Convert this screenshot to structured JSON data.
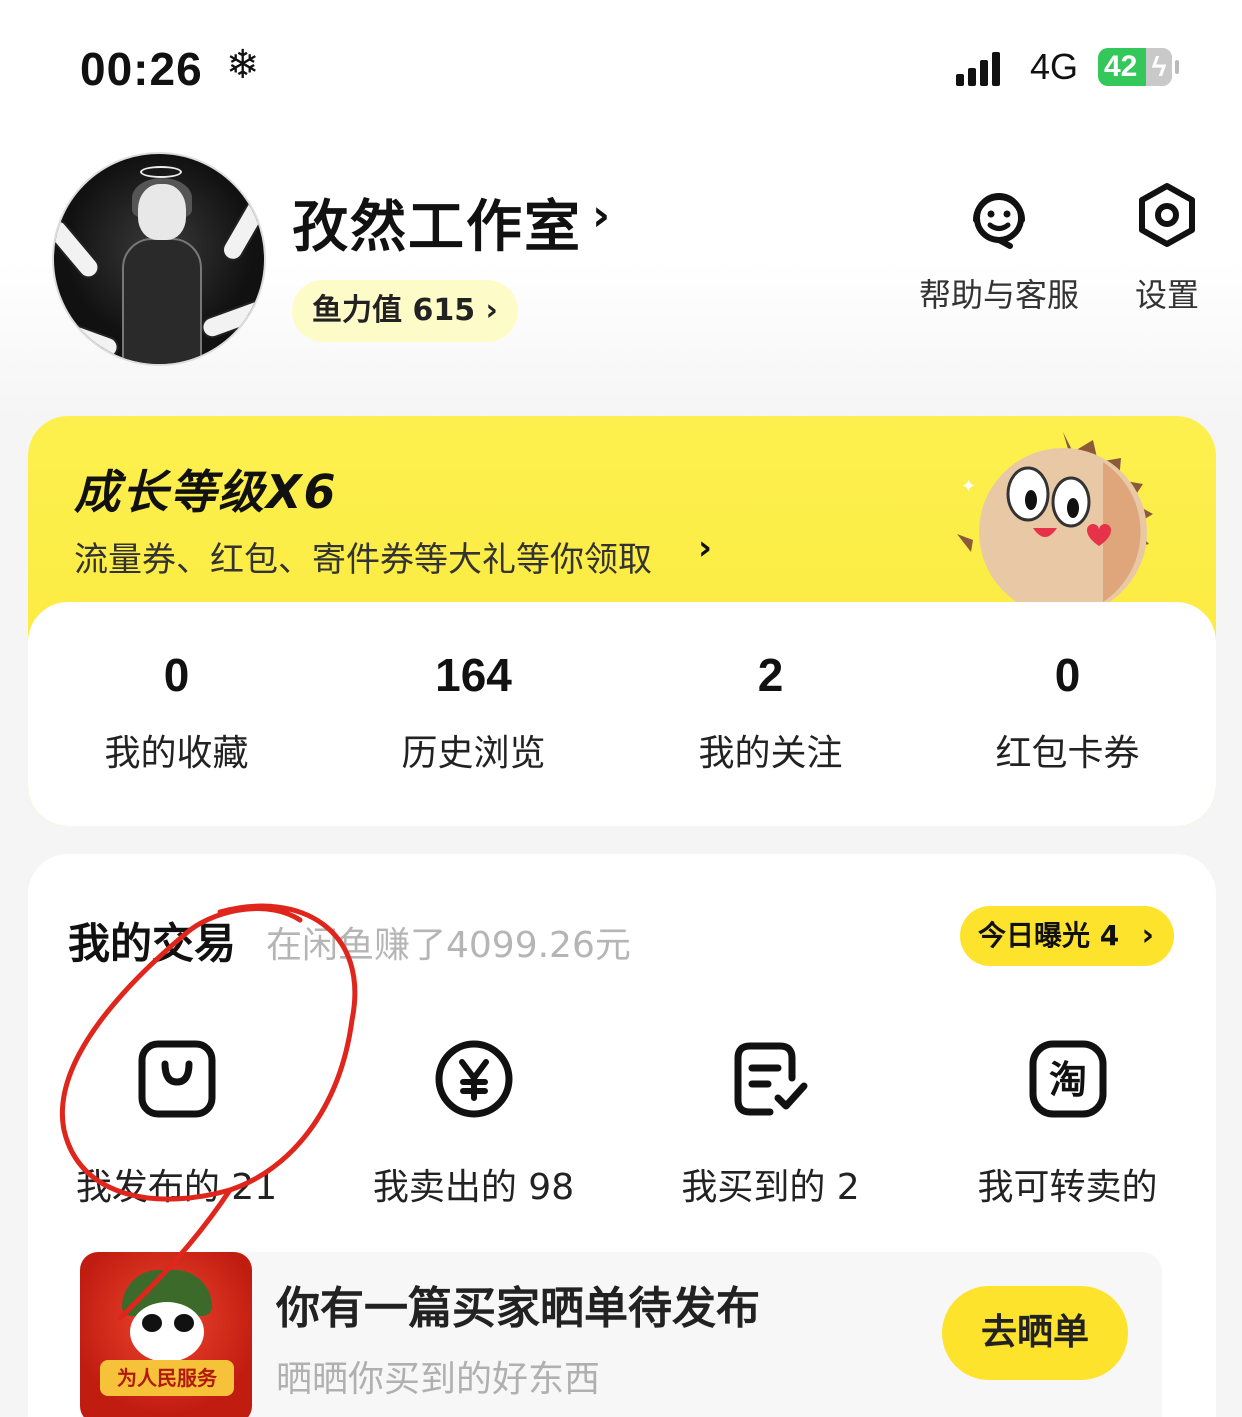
{
  "status_bar": {
    "time": "00:26",
    "network": "4G",
    "battery": "42"
  },
  "profile": {
    "name": "孜然工作室",
    "fish_power": "鱼力值 615"
  },
  "top_actions": [
    {
      "label": "帮助与客服",
      "icon": "customer-service-icon"
    },
    {
      "label": "设置",
      "icon": "settings-hexagon-icon"
    }
  ],
  "growth": {
    "title": "成长等级X6",
    "subtitle": "流量券、红包、寄件券等大礼等你领取"
  },
  "stats": [
    {
      "value": "0",
      "label": "我的收藏"
    },
    {
      "value": "164",
      "label": "历史浏览"
    },
    {
      "value": "2",
      "label": "我的关注"
    },
    {
      "value": "0",
      "label": "红包卡券"
    }
  ],
  "trade": {
    "title": "我的交易",
    "subtitle": "在闲鱼赚了4099.26元",
    "exposure": "今日曝光 4",
    "items": [
      {
        "label": "我发布的 21",
        "icon": "bag-icon"
      },
      {
        "label": "我卖出的 98",
        "icon": "yuan-circle-icon"
      },
      {
        "label": "我买到的 2",
        "icon": "order-check-icon"
      },
      {
        "label": "我可转卖的",
        "icon": "taobao-icon"
      }
    ]
  },
  "promo": {
    "title": "你有一篇买家晒单待发布",
    "subtitle": "晒晒你买到的好东西",
    "button": "去晒单",
    "thumb_ribbon": "为人民服务"
  },
  "colors": {
    "accent_yellow": "#fde32c",
    "annotation_red": "#e0261c",
    "battery_green": "#34c759"
  }
}
